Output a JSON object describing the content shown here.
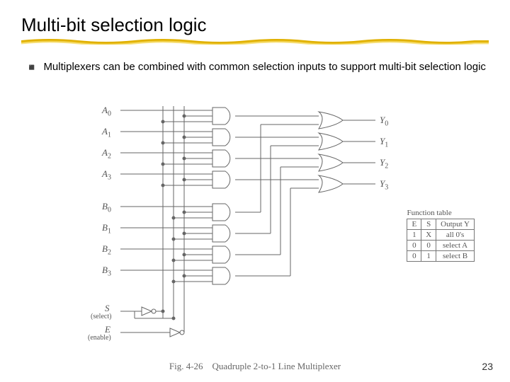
{
  "title": "Multi-bit selection logic",
  "bullet_text": "Multiplexers can be combined with common selection inputs to support multi-bit selection logic",
  "inputs_a": [
    "A",
    "A",
    "A",
    "A"
  ],
  "inputs_a_sub": [
    "0",
    "1",
    "2",
    "3"
  ],
  "inputs_b": [
    "B",
    "B",
    "B",
    "B"
  ],
  "inputs_b_sub": [
    "0",
    "1",
    "2",
    "3"
  ],
  "outputs": [
    "Y",
    "Y",
    "Y",
    "Y"
  ],
  "outputs_sub": [
    "0",
    "1",
    "2",
    "3"
  ],
  "select_label": "S",
  "select_sublabel": "(select)",
  "enable_label": "E",
  "enable_sublabel": "(enable)",
  "function_table": {
    "caption": "Function table",
    "headers": [
      "E",
      "S",
      "Output Y"
    ],
    "rows": [
      [
        "1",
        "X",
        "all 0's"
      ],
      [
        "0",
        "0",
        "select A"
      ],
      [
        "0",
        "1",
        "select B"
      ]
    ]
  },
  "figure_caption": "Fig. 4-26 Quadruple 2-to-1 Line Multiplexer",
  "page_number": "23"
}
